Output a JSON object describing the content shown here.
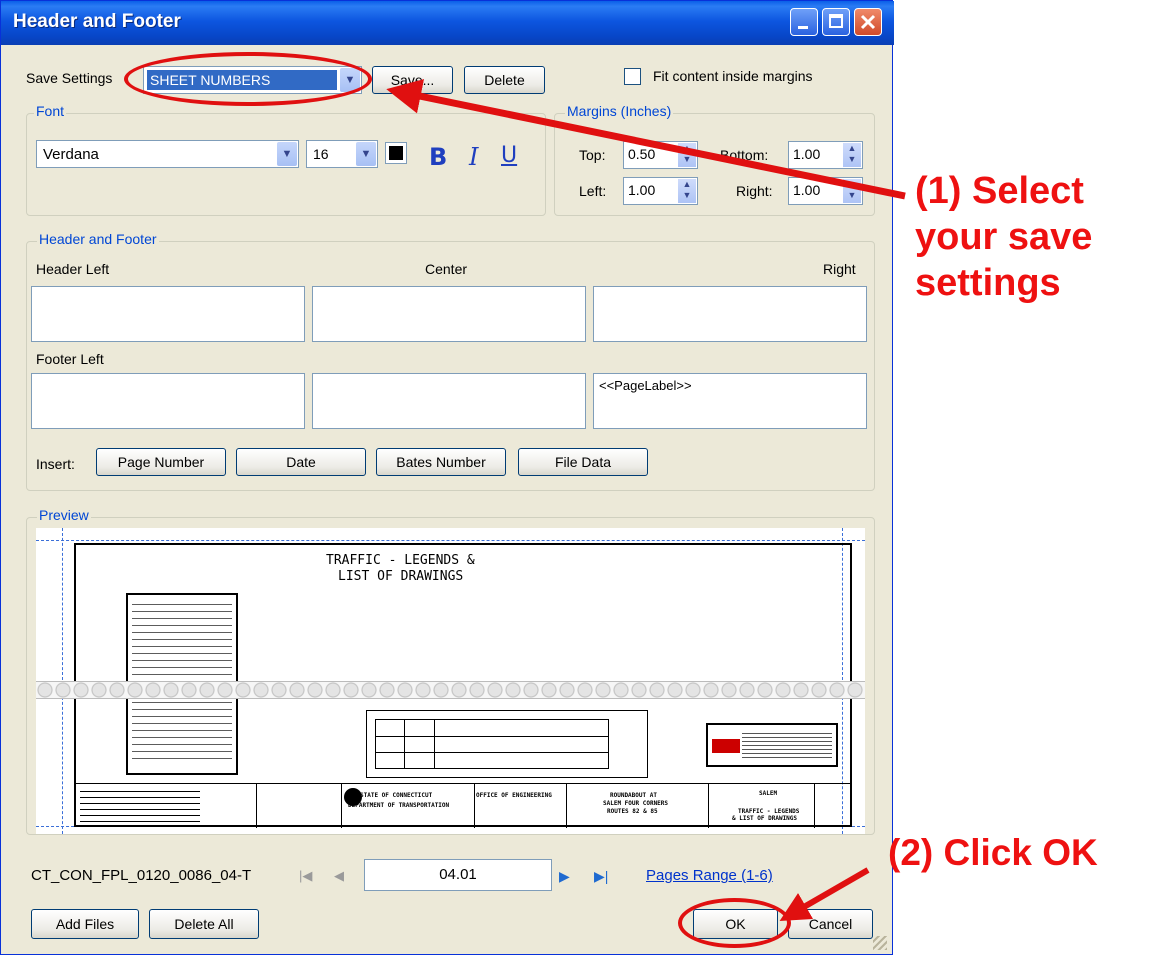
{
  "window": {
    "title": "Header and Footer"
  },
  "save_settings": {
    "label": "Save Settings",
    "value": "SHEET NUMBERS",
    "save_button": "Save...",
    "delete_button": "Delete"
  },
  "fit_content": {
    "label": "Fit content inside margins",
    "checked": false
  },
  "font": {
    "group_title": "Font",
    "family": "Verdana",
    "size": "16",
    "bold": "B",
    "italic": "I",
    "underline": "U"
  },
  "margins": {
    "group_title": "Margins (Inches)",
    "top_label": "Top:",
    "top": "0.50",
    "bottom_label": "Bottom:",
    "bottom": "1.00",
    "left_label": "Left:",
    "left": "1.00",
    "right_label": "Right:",
    "right": "1.00"
  },
  "hf": {
    "group_title": "Header and Footer",
    "header_left": "Header Left",
    "center": "Center",
    "right": "Right",
    "footer_left": "Footer Left",
    "footer_right_value": "<<PageLabel>>"
  },
  "insert": {
    "label": "Insert:",
    "page_number": "Page Number",
    "date": "Date",
    "bates_number": "Bates Number",
    "file_data": "File Data"
  },
  "preview": {
    "group_title": "Preview",
    "drawing_title_line1": "TRAFFIC - LEGENDS &",
    "drawing_title_line2": "LIST OF DRAWINGS",
    "state_line1": "STATE OF CONNECTICUT",
    "state_line2": "DEPARTMENT OF TRANSPORTATION",
    "office": "OFFICE OF ENGINEERING",
    "project_line1": "ROUNDABOUT AT",
    "project_line2": "SALEM FOUR CORNERS",
    "project_line3": "ROUTES 82 & 85",
    "town": "SALEM",
    "sheet_title_line1": "TRAFFIC - LEGENDS",
    "sheet_title_line2": "& LIST OF DRAWINGS"
  },
  "nav": {
    "file_name": "CT_CON_FPL_0120_0086_04-T",
    "page_value": "04.01",
    "pages_range": "Pages Range (1-6)"
  },
  "bottom": {
    "add_files": "Add Files",
    "delete_all": "Delete All",
    "ok": "OK",
    "cancel": "Cancel"
  },
  "annotations": {
    "step1_line1": "(1) Select",
    "step1_line2": "your save",
    "step1_line3": "settings",
    "step2": "(2) Click OK"
  },
  "colors": {
    "title_bar": "#0a5fe8",
    "dialog_bg": "#ece9d8",
    "annotation_red": "#e01010",
    "link_blue": "#0033cc",
    "group_title_blue": "#0046d5"
  }
}
